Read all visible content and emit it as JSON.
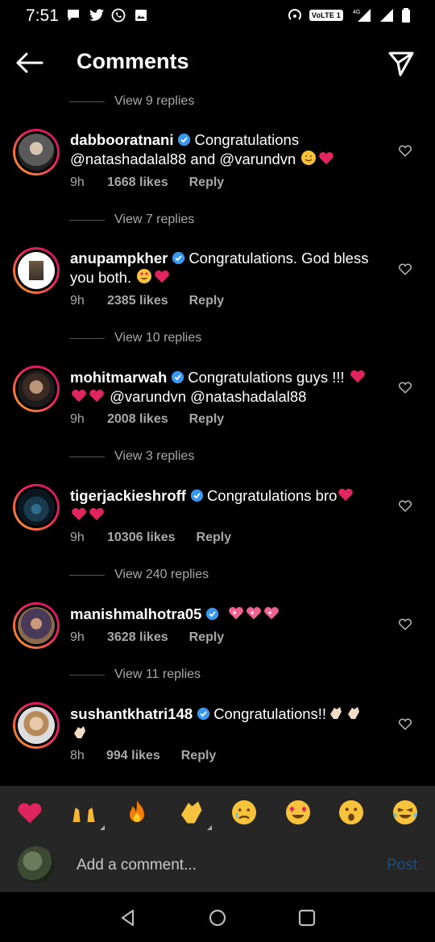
{
  "status": {
    "time": "7:51",
    "network_badge": "VoLTE 1",
    "network_gen": "4G"
  },
  "header": {
    "title": "Comments"
  },
  "comments": [
    {
      "view_replies": "View 9 replies",
      "username": "dabbooratnani",
      "text": "Congratulations @natashadalal88 and @varundvn",
      "emojis": [
        "hug-face-emoji",
        "red-heart-emoji"
      ],
      "time": "9h",
      "likes": "1668 likes",
      "reply": "Reply"
    },
    {
      "view_replies": "View 7 replies",
      "username": "anupampkher",
      "text": "Congratulations. God bless you both.",
      "emojis": [
        "heart-eyes-emoji",
        "red-heart-emoji"
      ],
      "time": "9h",
      "likes": "2385 likes",
      "reply": "Reply"
    },
    {
      "view_replies": "View 10 replies",
      "username": "mohitmarwah",
      "text_a": "Congratulations guys !!!",
      "text_b": "@varundvn @natashadalal88",
      "emojis": [
        "red-heart-emoji",
        "red-heart-emoji",
        "red-heart-emoji"
      ],
      "time": "9h",
      "likes": "2008 likes",
      "reply": "Reply"
    },
    {
      "view_replies": "View 3 replies",
      "username": "tigerjackieshroff",
      "text": "Congratulations bro",
      "emojis": [
        "red-heart-emoji",
        "red-heart-emoji",
        "red-heart-emoji"
      ],
      "time": "9h",
      "likes": "10306 likes",
      "reply": "Reply"
    },
    {
      "view_replies": "View 240 replies",
      "username": "manishmalhotra05",
      "text": "",
      "emojis": [
        "sparkling-heart-emoji",
        "sparkling-heart-emoji",
        "sparkling-heart-emoji"
      ],
      "time": "9h",
      "likes": "3628 likes",
      "reply": "Reply"
    },
    {
      "view_replies": "View 11 replies",
      "username": "sushantkhatri148",
      "text": "Congratulations!!",
      "emojis": [
        "clapping-hands-emoji",
        "clapping-hands-emoji",
        "clapping-hands-emoji"
      ],
      "time": "8h",
      "likes": "994 likes",
      "reply": "Reply"
    }
  ],
  "emoji_bar": [
    "red-heart",
    "raising-hands",
    "fire",
    "clapping-hands",
    "crying-face",
    "heart-eyes",
    "astonished-face",
    "tears-of-joy"
  ],
  "composer": {
    "placeholder": "Add a comment...",
    "post_label": "Post"
  },
  "colors": {
    "verified": "#3897f0",
    "heart": "#e0245e",
    "post_disabled": "#1f4d79",
    "ring": "#e91e63"
  }
}
